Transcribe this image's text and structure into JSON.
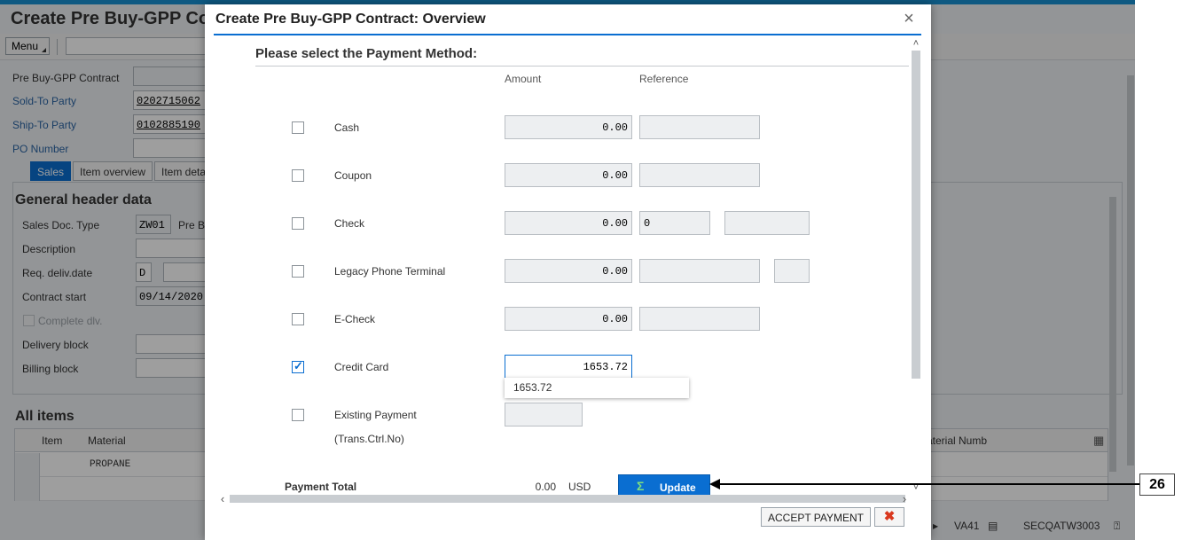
{
  "background_app": {
    "title": "Create Pre Buy-GPP Co",
    "menu_label": "Menu",
    "header_fields": [
      {
        "label": "Pre Buy-GPP Contract",
        "value": ""
      },
      {
        "label": "Sold-To Party",
        "value": "0202715062"
      },
      {
        "label": "Ship-To Party",
        "value": "0102885190"
      },
      {
        "label": "PO Number",
        "value": ""
      }
    ],
    "tabs": [
      "Sales",
      "Item overview",
      "Item deta"
    ],
    "general_header": {
      "title": "General header data",
      "sales_doc_type_label": "Sales Doc. Type",
      "sales_doc_type_value": "ZW01",
      "sales_doc_type_text": "Pre B",
      "description_label": "Description",
      "req_deliv_date_label": "Req. deliv.date",
      "req_deliv_date_prefix": "D",
      "contract_start_label": "Contract start",
      "contract_start_value": "09/14/2020",
      "complete_dlv_label": "Complete dlv.",
      "delivery_block_label": "Delivery block",
      "billing_block_label": "Billing block"
    },
    "all_items": {
      "title": "All items",
      "columns": [
        "Item",
        "Material",
        "aterial Numb"
      ],
      "rows": [
        {
          "item": "",
          "material": "PROPANE"
        },
        {
          "item": "",
          "material": ""
        }
      ]
    },
    "status_bar": {
      "transaction": "VA41",
      "system": "SECQATW3003"
    }
  },
  "dialog": {
    "title": "Create Pre Buy-GPP Contract: Overview",
    "close_glyph": "×",
    "section_title": "Please select the Payment Method:",
    "column_amount": "Amount",
    "column_reference": "Reference",
    "payment_methods": [
      {
        "label": "Cash",
        "checked": false,
        "amount": "0.00",
        "reference": "",
        "extra": null
      },
      {
        "label": "Coupon",
        "checked": false,
        "amount": "0.00",
        "reference": "",
        "extra": null
      },
      {
        "label": "Check",
        "checked": false,
        "amount": "0.00",
        "reference": "0",
        "extra": ""
      },
      {
        "label": "Legacy Phone Terminal",
        "checked": false,
        "amount": "0.00",
        "reference": "",
        "extra": ""
      },
      {
        "label": "E-Check",
        "checked": false,
        "amount": "0.00",
        "reference": "",
        "extra": null
      },
      {
        "label": "Credit Card",
        "checked": true,
        "amount": "1653.72",
        "reference": null,
        "extra": null
      },
      {
        "label": "Existing Payment",
        "sublabel": "(Trans.Ctrl.No)",
        "checked": false,
        "amount": "",
        "reference": null,
        "extra": null
      }
    ],
    "autocomplete_suggestion": "1653.72",
    "payment_total_label": "Payment Total",
    "payment_total_amount": "0.00",
    "payment_total_currency": "USD",
    "update_button_label": "Update",
    "accept_payment_label": "ACCEPT PAYMENT",
    "cancel_glyph": "✖"
  },
  "callout": {
    "step_number": "26"
  },
  "colors": {
    "accent": "#0a6ed1",
    "shell_bar": "#1890d2",
    "cancel_red": "#d9381e",
    "sigma_green": "#7fe07f"
  }
}
